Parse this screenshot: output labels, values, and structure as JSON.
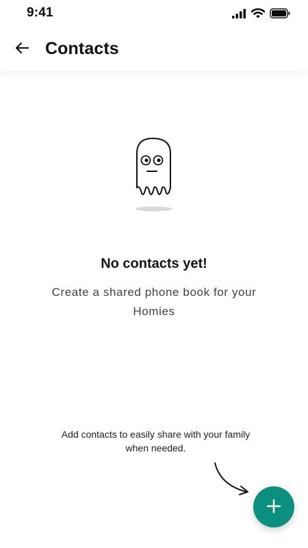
{
  "status_bar": {
    "time": "9:41",
    "icons": [
      "signal-icon",
      "wifi-icon",
      "battery-icon"
    ]
  },
  "header": {
    "back_icon": "arrow-left-icon",
    "title": "Contacts"
  },
  "empty_state": {
    "illustration": "ghost-illustration",
    "title": "No contacts yet!",
    "subtitle": "Create a shared phone book for your Homies"
  },
  "hint": {
    "text": "Add contacts to easily share with your family when needed.",
    "arrow_icon": "curved-arrow-icon"
  },
  "fab": {
    "icon": "plus-icon"
  },
  "colors": {
    "accent": "#0b8f7e",
    "text_primary": "#111418",
    "text_secondary": "#3c4248",
    "background": "#ffffff"
  }
}
